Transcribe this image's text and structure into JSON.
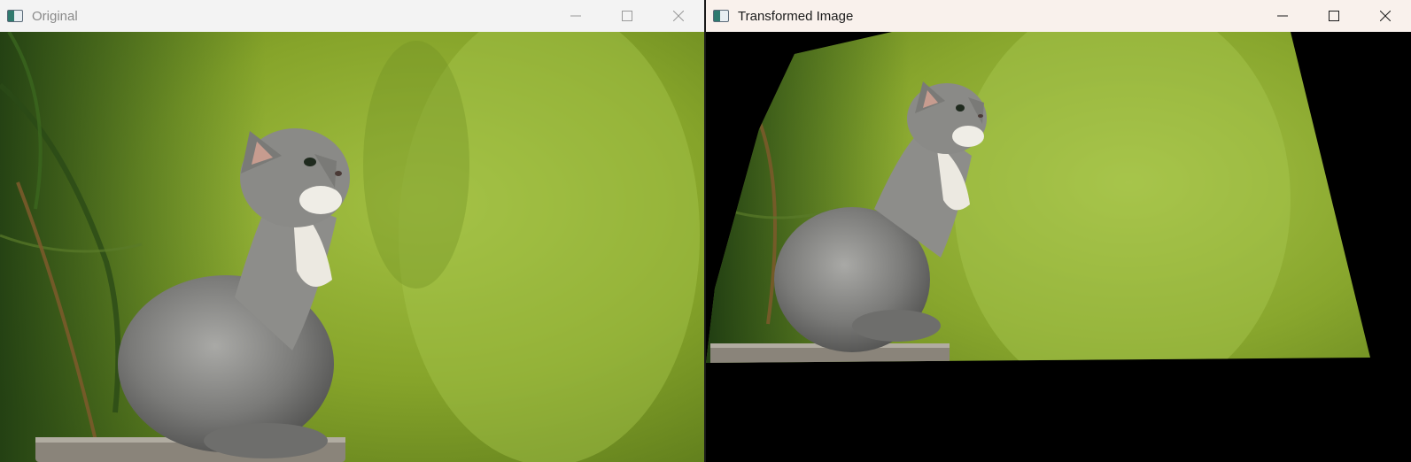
{
  "windows": {
    "left": {
      "title": "Original",
      "state": "inactive",
      "controls": {
        "minimize_icon": "minimize-icon",
        "maximize_icon": "maximize-icon",
        "close_icon": "close-icon"
      },
      "image": {
        "subject": "kitten photo",
        "transform": "none"
      }
    },
    "right": {
      "title": "Transformed Image",
      "state": "active",
      "controls": {
        "minimize_icon": "minimize-icon",
        "maximize_icon": "maximize-icon",
        "close_icon": "close-icon"
      },
      "image": {
        "subject": "kitten photo",
        "transform": "perspective warp",
        "background_color": "#000000"
      }
    }
  },
  "colors": {
    "titlebar_inactive": "#f3f3f3",
    "titlebar_active": "#f9f1ec",
    "foliage_bg": "#8fae2e",
    "fur_gray": "#7d7d7d",
    "stone": "#8a847a"
  }
}
